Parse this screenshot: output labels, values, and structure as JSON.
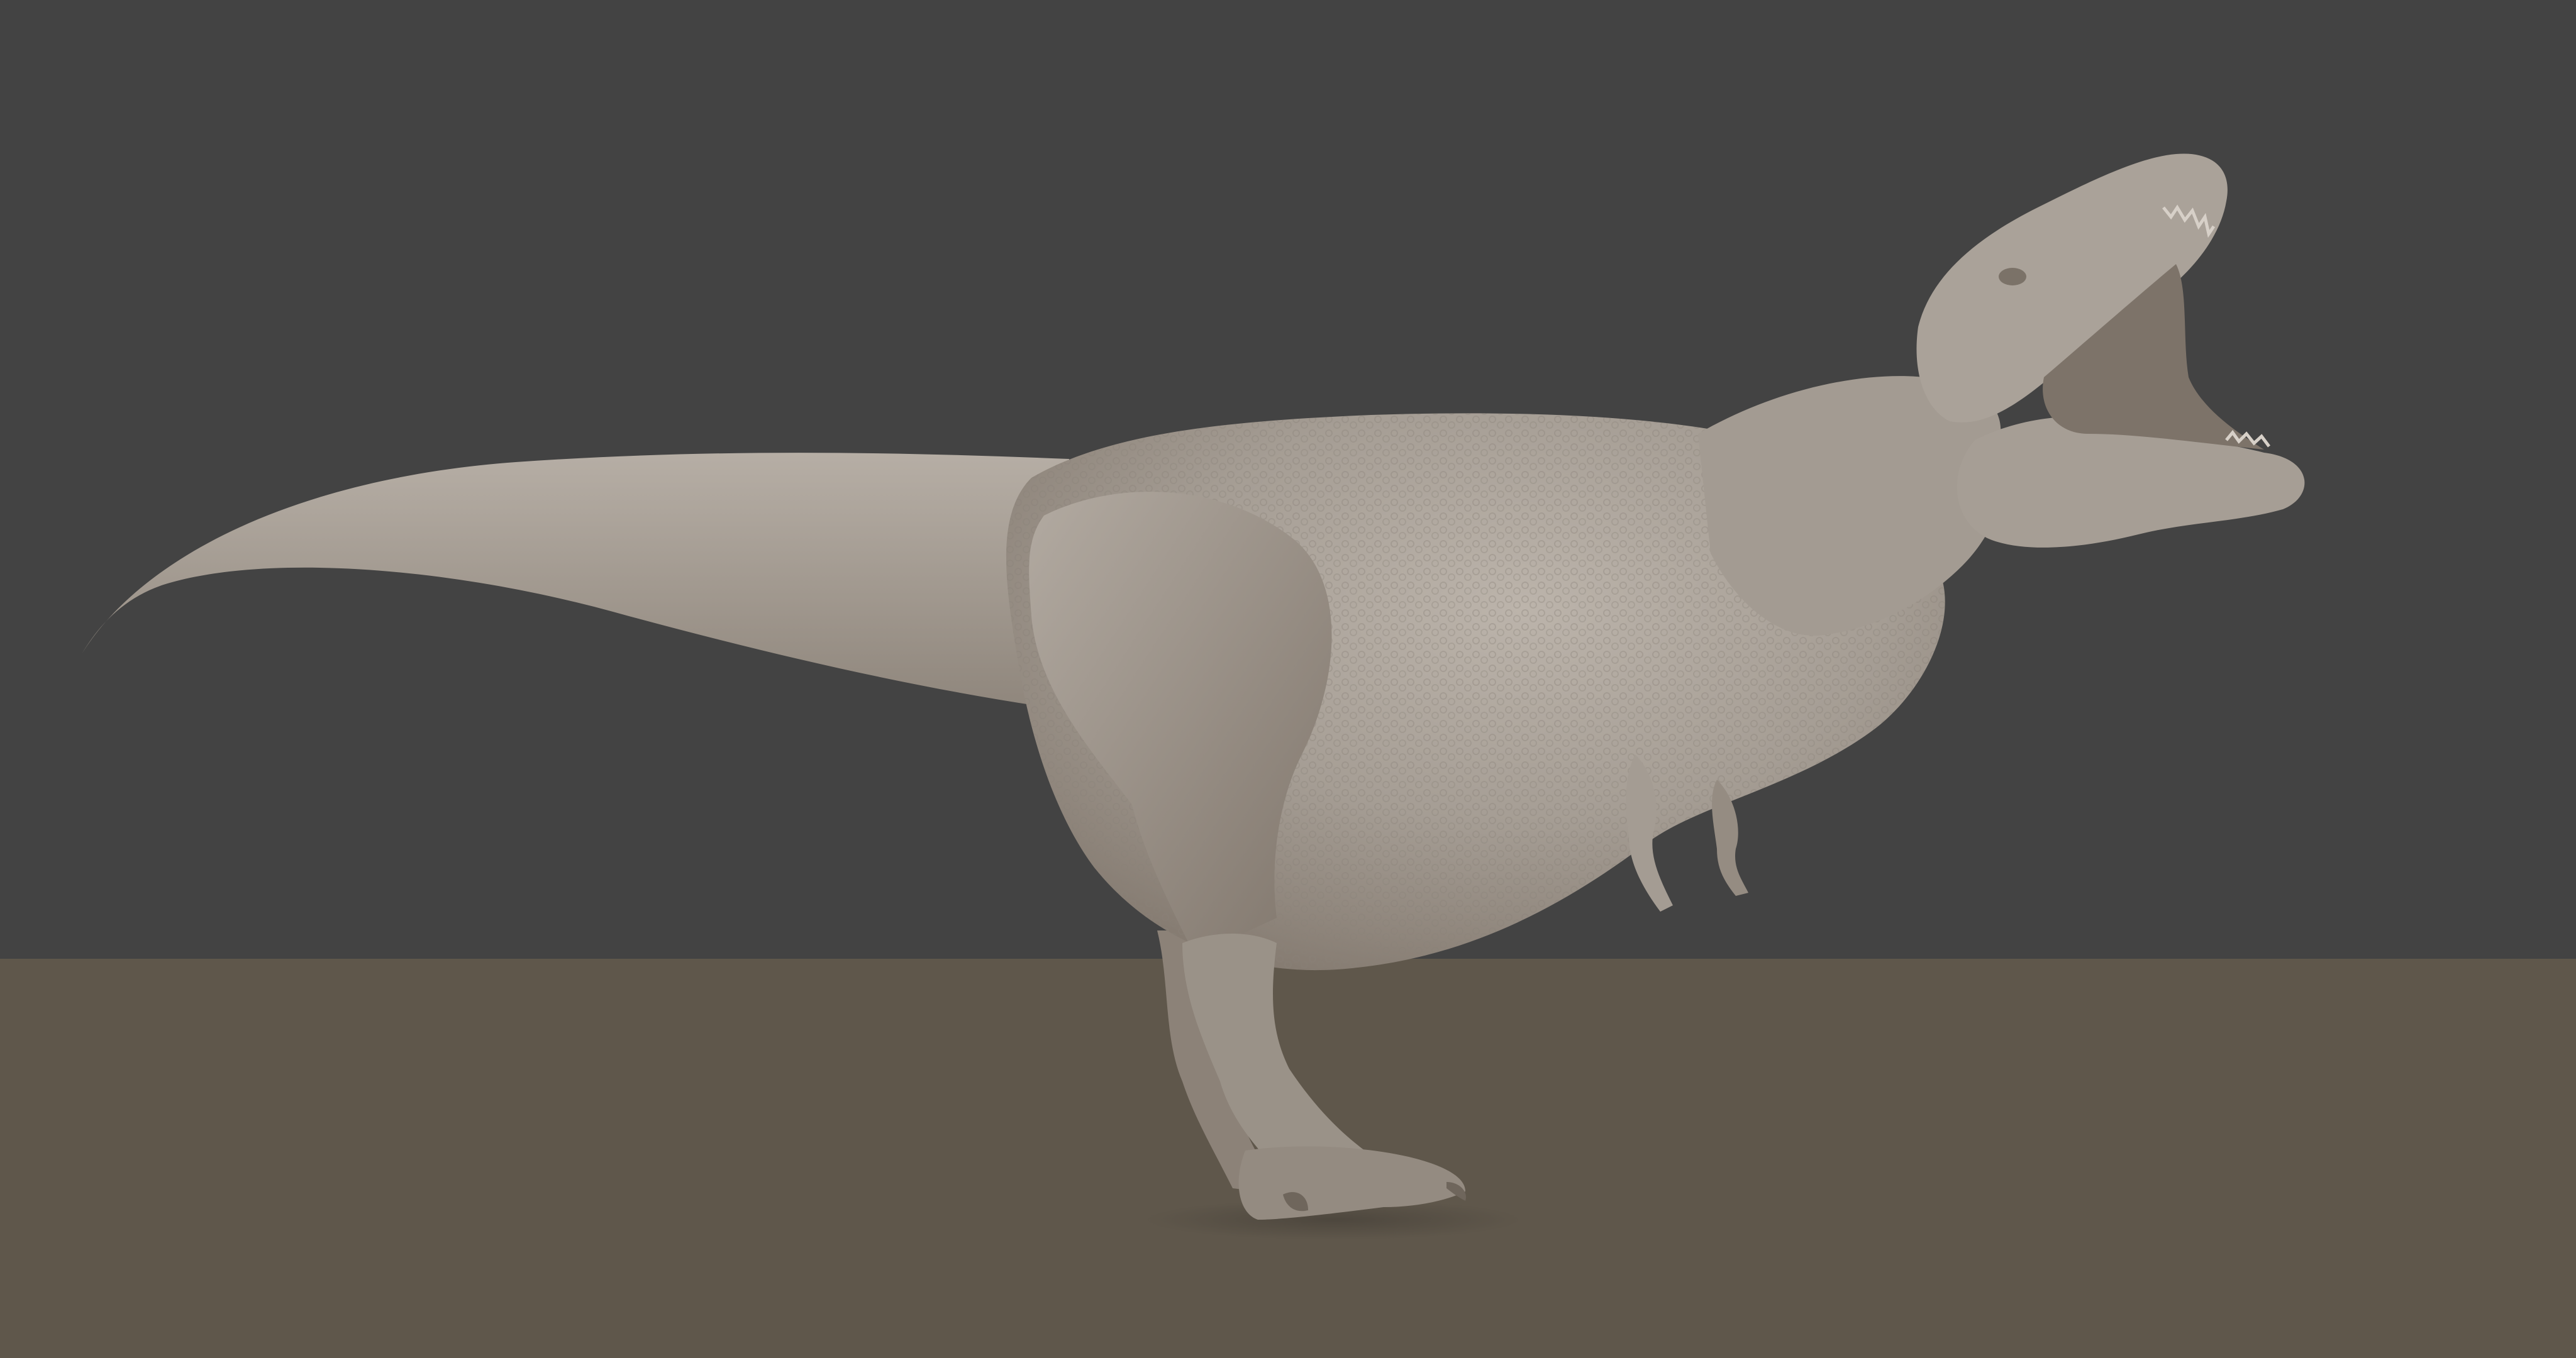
{
  "viewport": {
    "background_color": "#434343",
    "floor_color": "#5f574b",
    "model_color": "#a59d94",
    "model_shadow_color": "#7d7369",
    "model_highlight_color": "#c2bab1",
    "model_subject": "tyrannosaurus-rex-sculpt",
    "pose": "roaring-side-view-facing-right",
    "shading": "clay-matcap-unlit"
  }
}
